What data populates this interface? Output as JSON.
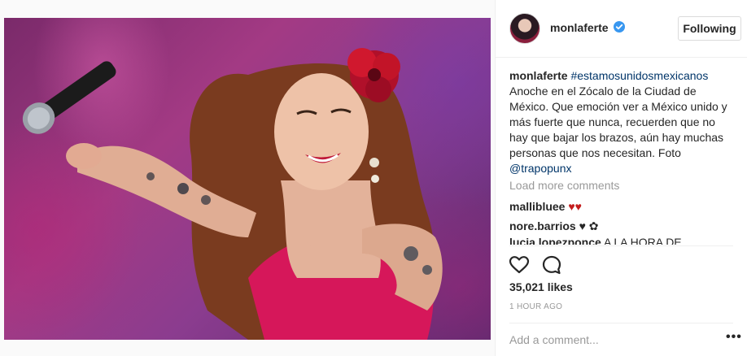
{
  "post": {
    "author": "monlaferte",
    "follow_label": "Following",
    "caption": {
      "username": "monlaferte",
      "hashtag": "#estamosunidosmexicanos",
      "text": "Anoche en el Zócalo de la Ciudad de México. Que emoción ver a México unido y más fuerte que nunca, recuerden que no hay que bajar los brazos, aún hay muchas personas que nos necesitan. Foto",
      "mention": "@trapopunx"
    },
    "load_more": "Load more comments",
    "comments": [
      {
        "username": "mallibluee",
        "text": "♥♥"
      },
      {
        "username": "nore.barrios",
        "text": "♥ ✿"
      },
      {
        "username": "lucia.lopezponce",
        "text": "A LA HORA DE"
      }
    ],
    "likes": "35,021 likes",
    "time": "1 HOUR AGO",
    "add_comment_placeholder": "Add a comment...",
    "more_label": "•••"
  },
  "icons": {
    "like": "heart-outline-icon",
    "comment": "speech-bubble-icon",
    "verified": "verified-badge-icon",
    "more": "ellipsis-icon"
  },
  "colors": {
    "verified": "#3897f0",
    "hashtag": "#003569",
    "muted": "#999999"
  }
}
